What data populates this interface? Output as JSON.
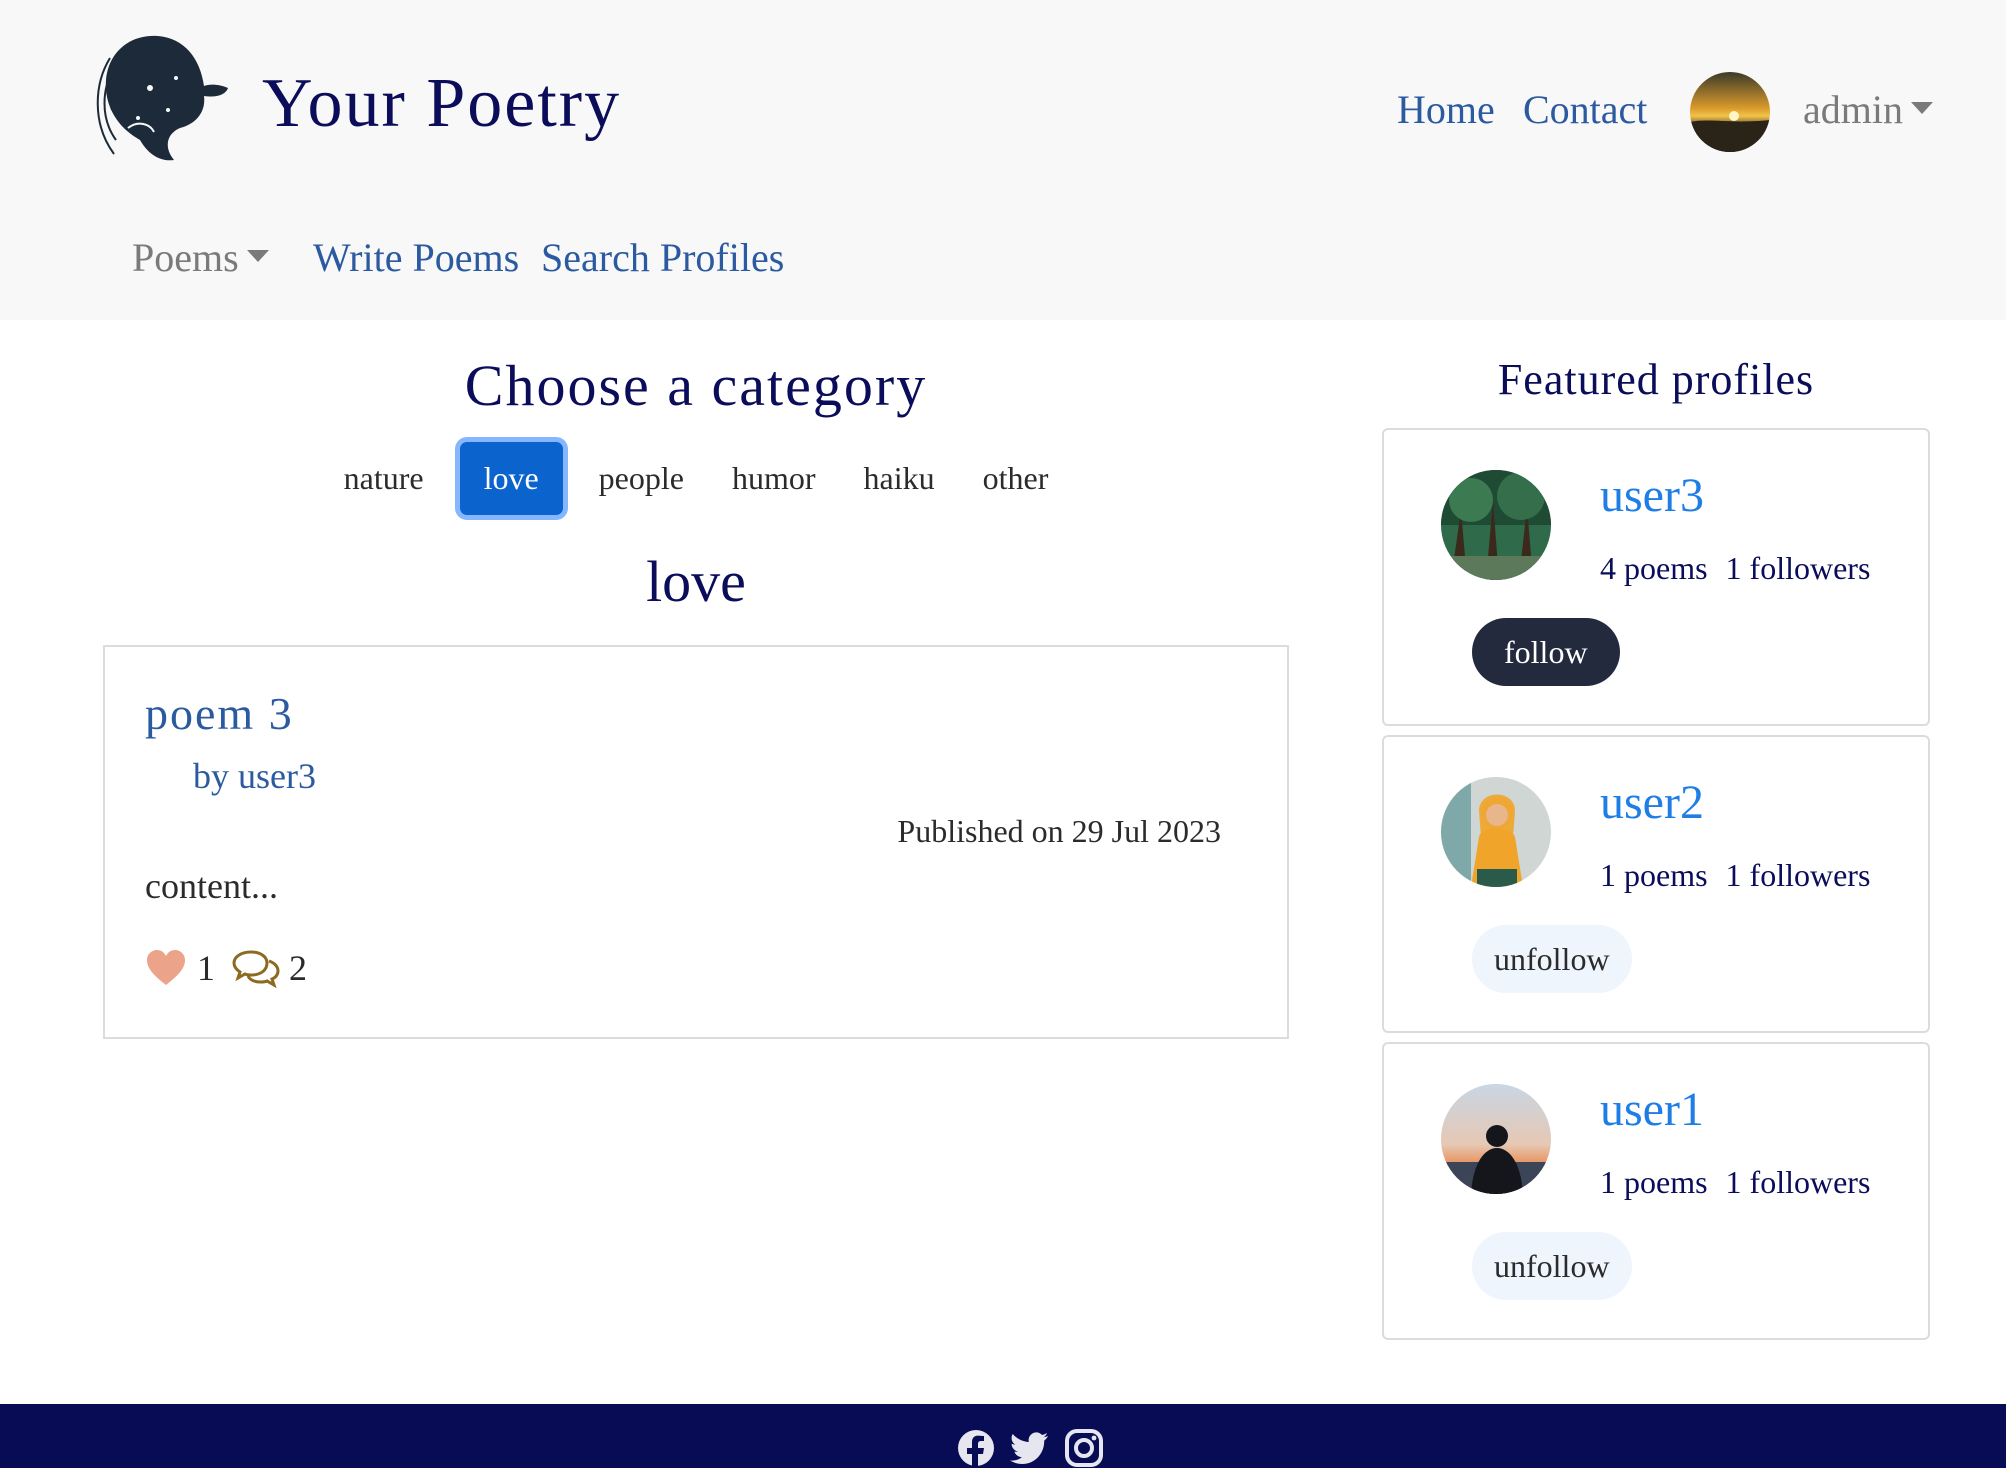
{
  "header": {
    "brand": "Your Poetry",
    "nav": {
      "home": "Home",
      "contact": "Contact"
    },
    "user_menu": {
      "label": "admin"
    },
    "subnav": {
      "poems": "Poems",
      "write": "Write Poems",
      "search": "Search Profiles"
    }
  },
  "categories": {
    "heading": "Choose a category",
    "items": [
      "nature",
      "love",
      "people",
      "humor",
      "haiku",
      "other"
    ],
    "selected": "love"
  },
  "current_category": "love",
  "poems": [
    {
      "title": "poem 3",
      "author": "by user3",
      "published": "Published on 29 Jul 2023",
      "content": "content...",
      "likes": "1",
      "comments": "2"
    }
  ],
  "featured": {
    "heading": "Featured profiles",
    "profiles": [
      {
        "name": "user3",
        "poems": "4 poems",
        "followers": "1 followers",
        "action": "follow"
      },
      {
        "name": "user2",
        "poems": "1 poems",
        "followers": "1 followers",
        "action": "unfollow"
      },
      {
        "name": "user1",
        "poems": "1 poems",
        "followers": "1 followers",
        "action": "unfollow"
      }
    ]
  },
  "footer": {
    "icons": [
      "facebook-icon",
      "twitter-icon",
      "instagram-icon"
    ]
  },
  "colors": {
    "primary_navy": "#0b0d5a",
    "link_blue": "#2c5aa0",
    "active_blue": "#0b63ce",
    "footer_bg": "#080c55"
  }
}
